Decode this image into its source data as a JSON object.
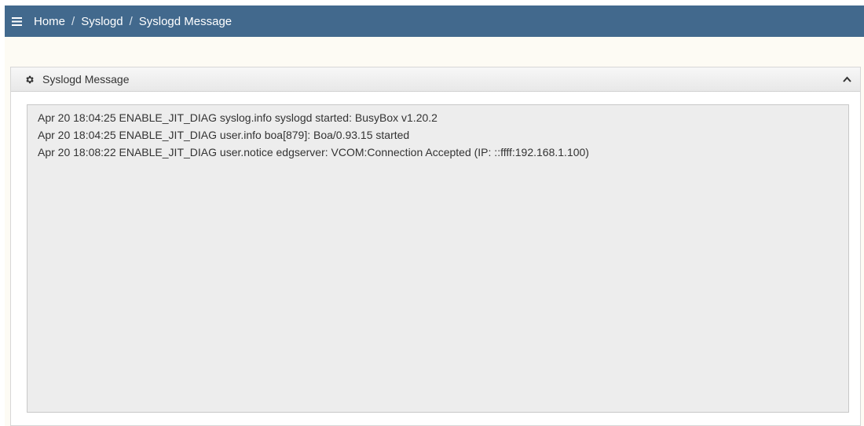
{
  "breadcrumb": {
    "home": "Home",
    "syslogd": "Syslogd",
    "current": "Syslogd Message",
    "separator": "/"
  },
  "panel": {
    "title": "Syslogd Message"
  },
  "log": {
    "lines": [
      "Apr 20 18:04:25 ENABLE_JIT_DIAG syslog.info syslogd started: BusyBox v1.20.2",
      "Apr 20 18:04:25 ENABLE_JIT_DIAG user.info boa[879]: Boa/0.93.15 started",
      "Apr 20 18:08:22 ENABLE_JIT_DIAG user.notice edgserver: VCOM:Connection Accepted (IP: ::ffff:192.168.1.100)"
    ]
  },
  "colors": {
    "topbar": "#42698d",
    "content_background": "#fdfbf4",
    "log_background": "#ededed"
  },
  "icons": {
    "menu": "hamburger-menu-icon",
    "panel": "gear-icon",
    "collapse": "chevron-up-icon"
  }
}
